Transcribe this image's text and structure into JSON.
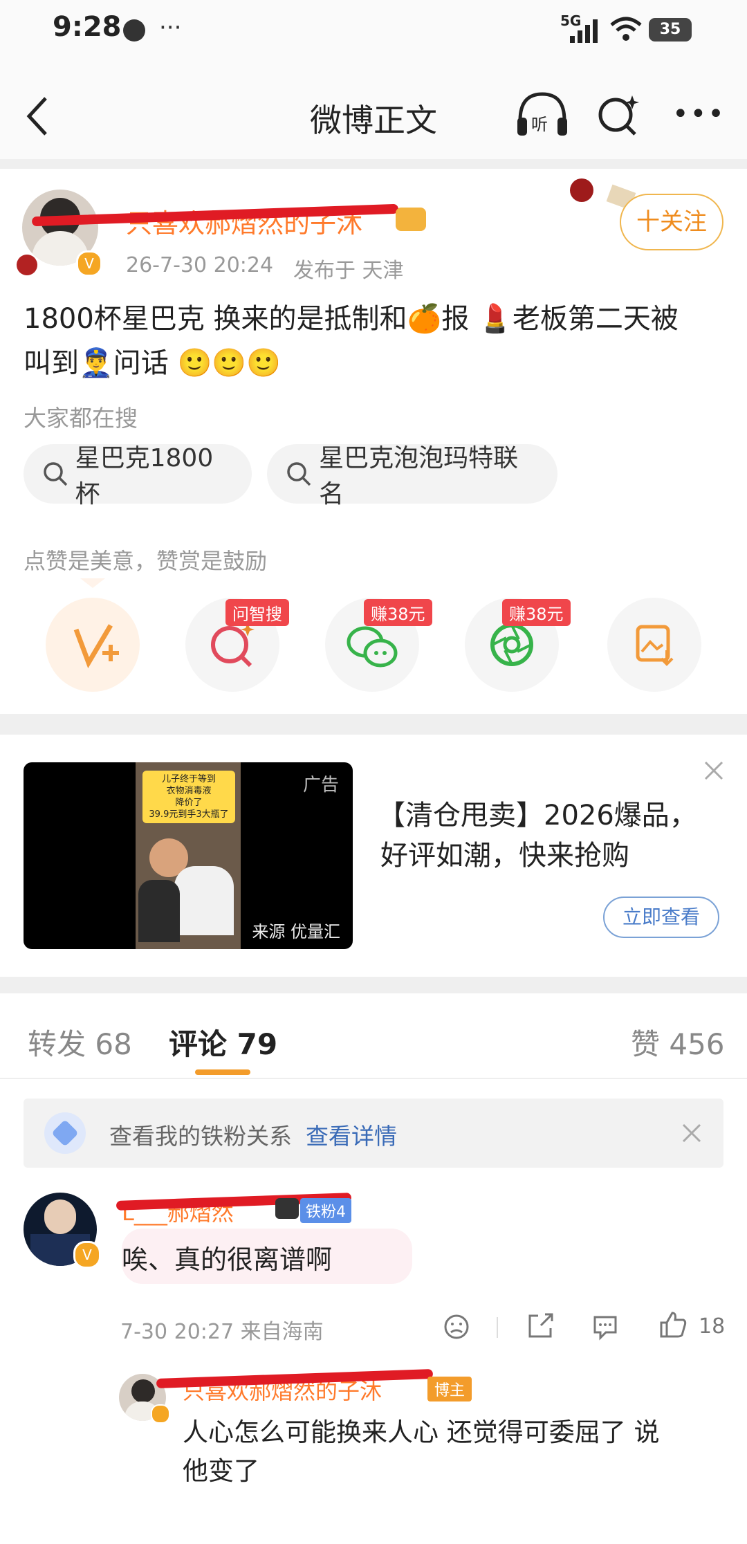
{
  "status_bar": {
    "time": "9:28",
    "network": "5G",
    "battery": "35"
  },
  "header": {
    "title": "微博正文"
  },
  "post": {
    "username": "只喜欢郝熠然的子沐",
    "meta_time": "26-7-30 20:24",
    "meta_location": "发布于 天津",
    "follow_label": "十关注",
    "text_line1": "1800杯星巴克 换来的是抵制和🍊报 💄老板第二天被",
    "text_line2": "叫到👮‍♂️问话 🙂🙂🙂",
    "search_title": "大家都在搜",
    "search_tags": [
      "星巴克1800杯",
      "星巴克泡泡玛特联名"
    ],
    "encourage_text": "点赞是美意，赞赏是鼓励",
    "action_badges": [
      "问智搜",
      "赚38元",
      "赚38元"
    ]
  },
  "ad": {
    "tag": "广告",
    "source": "来源 优量汇",
    "thumb_line1": "儿子终于等到",
    "thumb_line2": "衣物消毒液",
    "thumb_line3": "降价了",
    "thumb_line4": "39.9元到手3大瓶了",
    "line1": "【清仓甩卖】2026爆品，",
    "line2": "好评如潮，快来抢购",
    "button": "立即查看"
  },
  "tabs": {
    "repost": "转发 68",
    "comment": "评论 79",
    "like": "赞 456"
  },
  "fan_banner": {
    "text": "查看我的铁粉关系",
    "link": "查看详情"
  },
  "comment": {
    "username": "L___郝熠然",
    "fan_badge": "铁粉4",
    "text": "唉、真的很离谱啊",
    "time_loc": "7-30 20:27 来自海南",
    "likes": "18"
  },
  "reply": {
    "username": "只喜欢郝熠然的子沐",
    "badge": "博主",
    "line1": "人心怎么可能换来人心 还觉得可委屈了 说",
    "line2": "他变了"
  }
}
